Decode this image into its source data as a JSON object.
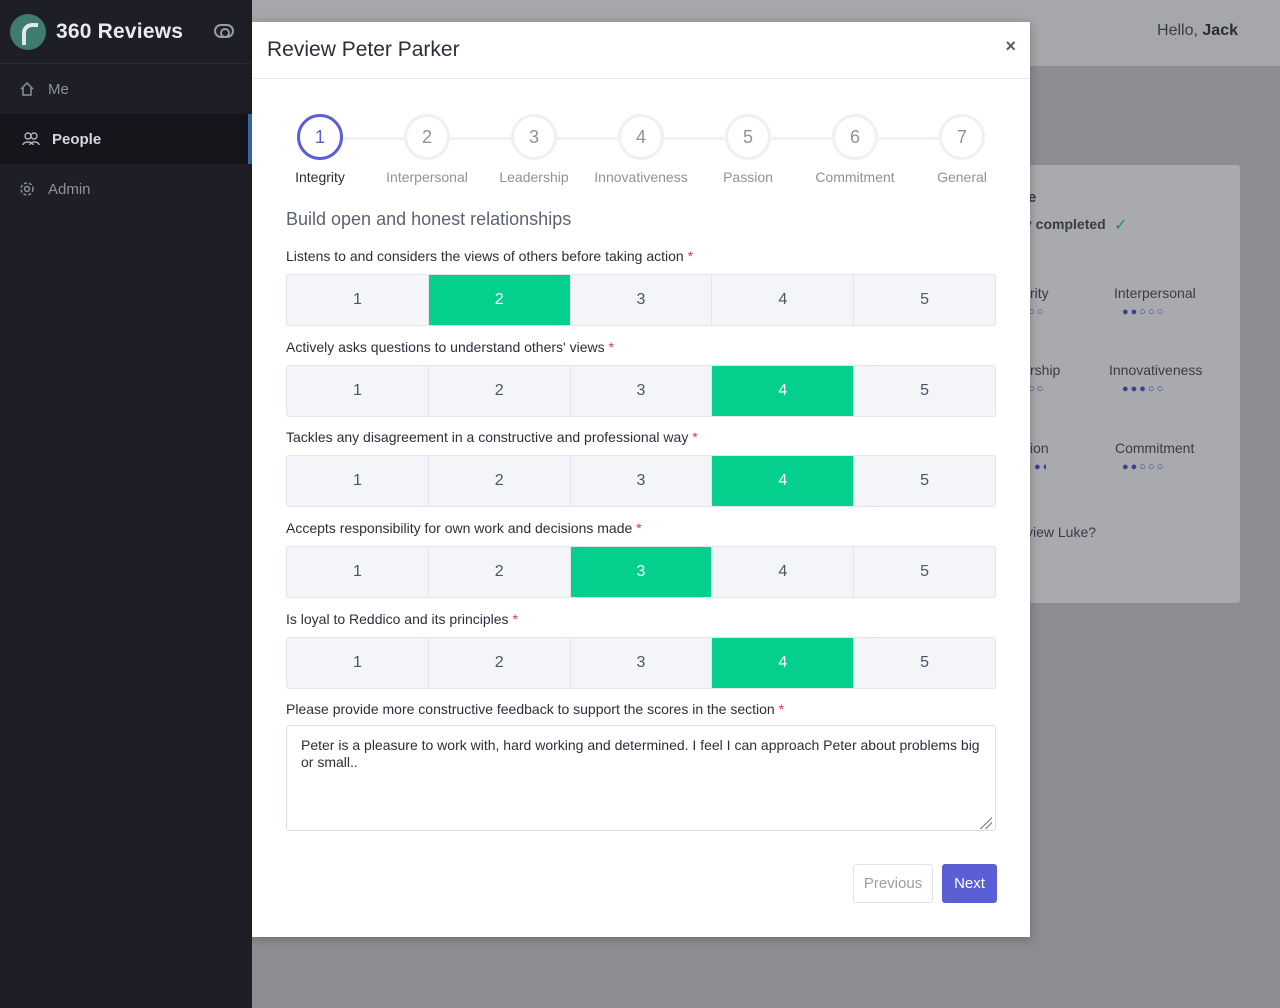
{
  "app": {
    "name": "360 Reviews"
  },
  "sidebar": {
    "items": [
      {
        "label": "Me",
        "icon": "home-icon"
      },
      {
        "label": "People",
        "icon": "people-icon",
        "active": true
      },
      {
        "label": "Admin",
        "icon": "gear-icon"
      }
    ]
  },
  "topbar": {
    "greeting": "Hello,",
    "user": "Jack"
  },
  "background_card": {
    "title_fragment": "e",
    "status_fragment": "v completed",
    "categories": [
      {
        "label": "rity",
        "dots": "○○"
      },
      {
        "label": "Interpersonal",
        "dots": "●●○○○"
      },
      {
        "label": "rship",
        "dots": "○○"
      },
      {
        "label": "Innovativeness",
        "dots": "●●●○○"
      },
      {
        "label": "ion",
        "dots": "●◐"
      },
      {
        "label": "Commitment",
        "dots": "●●○○○"
      }
    ],
    "question_fragment": "view Luke?"
  },
  "modal": {
    "title": "Review Peter Parker",
    "close": "×",
    "steps": [
      {
        "num": "1",
        "label": "Integrity",
        "active": true
      },
      {
        "num": "2",
        "label": "Interpersonal"
      },
      {
        "num": "3",
        "label": "Leadership"
      },
      {
        "num": "4",
        "label": "Innovativeness"
      },
      {
        "num": "5",
        "label": "Passion"
      },
      {
        "num": "6",
        "label": "Commitment"
      },
      {
        "num": "7",
        "label": "General"
      }
    ],
    "section_title": "Build open and honest relationships",
    "scale_options": [
      "1",
      "2",
      "3",
      "4",
      "5"
    ],
    "questions": [
      {
        "label": "Listens to and considers the views of others before taking action",
        "selected": 2
      },
      {
        "label": "Actively asks questions to understand others' views",
        "selected": 4
      },
      {
        "label": "Tackles any disagreement in a constructive and professional way",
        "selected": 4
      },
      {
        "label": "Accepts responsibility for own work and decisions made",
        "selected": 3
      },
      {
        "label": "Is loyal to Reddico and its principles",
        "selected": 4
      }
    ],
    "required_mark": "*",
    "feedback_label": "Please provide more constructive feedback to support the scores in the section",
    "feedback_value": "Peter is a pleasure to work with, hard working and determined. I feel I can approach Peter about problems big or small..",
    "previous_label": "Previous",
    "next_label": "Next"
  },
  "colors": {
    "accent": "#5b5fd6",
    "selected": "#04cf8c",
    "required": "#e0334f",
    "sidebar": "#1e1f26"
  }
}
